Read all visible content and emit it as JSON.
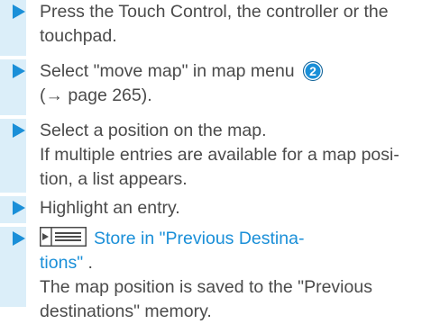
{
  "steps": [
    {
      "text": "Press the Touch Control, the controller or the\ntouchpad."
    },
    {
      "text": "Select \"move map\" in map menu",
      "badge": "2",
      "ref": "(→ page 265)."
    },
    {
      "text": "Select a position on the map.",
      "note": "If multiple entries are available for a map posi-\ntion, a list appears."
    },
    {
      "text": "Highlight an entry."
    },
    {
      "icon": "list-menu-symbol",
      "link": "Store in \"Previous Destina-\ntions\"",
      "suffix": " .",
      "note": "The map position is saved to the \"Previous\ndestinations\" memory."
    }
  ],
  "colors": {
    "accent": "#1a8fd8",
    "bar": "#dbeef9",
    "text": "#4a4a4a"
  }
}
